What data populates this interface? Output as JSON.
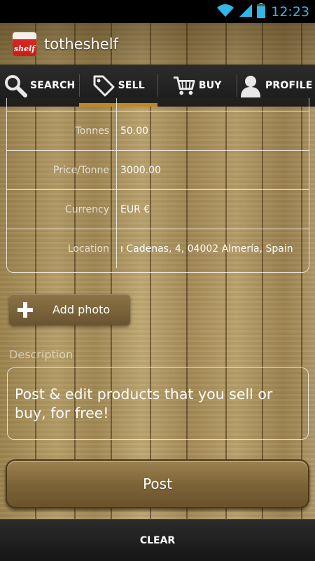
{
  "status_bar": {
    "time": "12:23",
    "icons": [
      "wifi-icon",
      "signal-icon",
      "battery-icon"
    ]
  },
  "app": {
    "title": "totheshelf",
    "icon_text": "shelf"
  },
  "tabs": [
    {
      "label": "SEARCH",
      "icon": "search-icon",
      "active": false
    },
    {
      "label": "SELL",
      "icon": "tag-icon",
      "active": true
    },
    {
      "label": "BUY",
      "icon": "cart-icon",
      "active": false
    },
    {
      "label": "PROFILE",
      "icon": "person-icon",
      "active": false
    }
  ],
  "form": {
    "rows": [
      {
        "label": "Tonnes",
        "value": "50.00"
      },
      {
        "label": "Price/Tonne",
        "value": "3000.00"
      },
      {
        "label": "Currency",
        "value": "EUR €"
      },
      {
        "label": "Location",
        "value": "ı Cadenas, 4, 04002 Almería, Spain"
      }
    ]
  },
  "add_photo": {
    "label": "Add photo"
  },
  "description": {
    "label": "Description",
    "value": "Post & edit products that you sell or buy, for free!"
  },
  "post_button": {
    "label": "Post"
  },
  "bottom_bar": {
    "label": "CLEAR"
  },
  "colors": {
    "accent": "#c98b1d",
    "status_time": "#33b5e5",
    "bar_dark": "#1a1a1a"
  }
}
